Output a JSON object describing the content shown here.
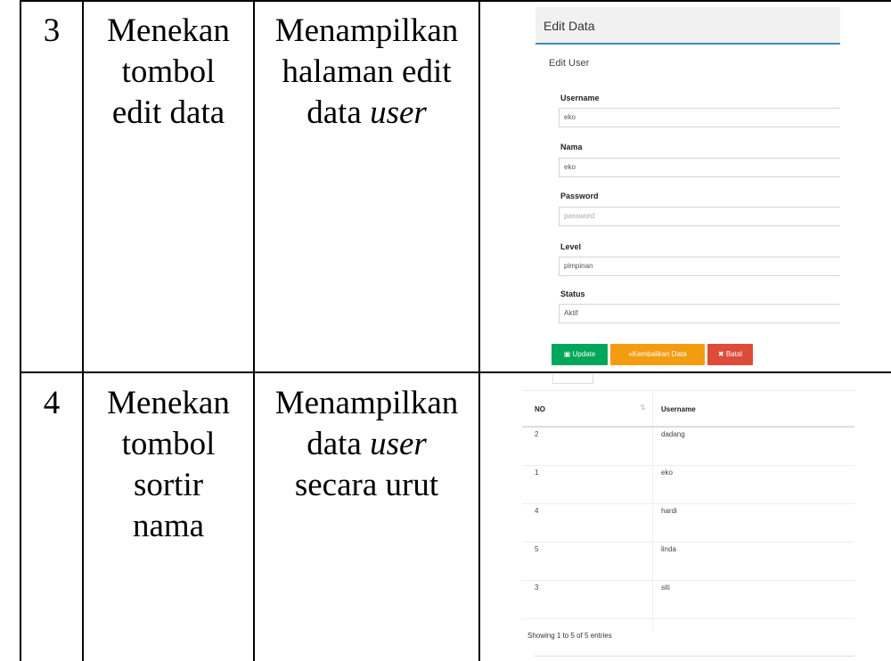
{
  "rows": [
    {
      "no": "3",
      "action": [
        "Menekan",
        "tombol",
        "edit data"
      ],
      "result": {
        "l1": "Menampilkan",
        "l2": "halaman edit",
        "l3_plain": "data ",
        "l3_italic": "user"
      }
    },
    {
      "no": "4",
      "action": [
        "Menekan",
        "tombol",
        "sortir",
        "nama"
      ],
      "result": {
        "l1": "Menampilkan",
        "l2_plain": "data ",
        "l2_italic": "user",
        "l3": "secara urut"
      }
    }
  ],
  "edit_form": {
    "header": "Edit Data",
    "subtitle": "Edit User",
    "fields": [
      {
        "label": "Username",
        "value": "eko",
        "placeholder": ""
      },
      {
        "label": "Nama",
        "value": "eko",
        "placeholder": ""
      },
      {
        "label": "Password",
        "value": "",
        "placeholder": "password"
      },
      {
        "label": "Level",
        "value": "pimpinan",
        "placeholder": ""
      },
      {
        "label": "Status",
        "value": "Aktif",
        "placeholder": ""
      }
    ],
    "buttons": {
      "update": "Update",
      "back": "Kembalikan Data",
      "cancel": "Batal"
    },
    "colors": {
      "update": "#00a65a",
      "back": "#f39c12",
      "cancel": "#dd4b39",
      "accent": "#3c8dbc"
    }
  },
  "user_table": {
    "columns": [
      "NO",
      "Username"
    ],
    "rows": [
      {
        "no": "2",
        "username": "dadang"
      },
      {
        "no": "1",
        "username": "eko"
      },
      {
        "no": "4",
        "username": "hardi"
      },
      {
        "no": "5",
        "username": "linda"
      },
      {
        "no": "3",
        "username": "siti"
      }
    ],
    "footer": "Showing 1 to 5 of 5 entries"
  }
}
